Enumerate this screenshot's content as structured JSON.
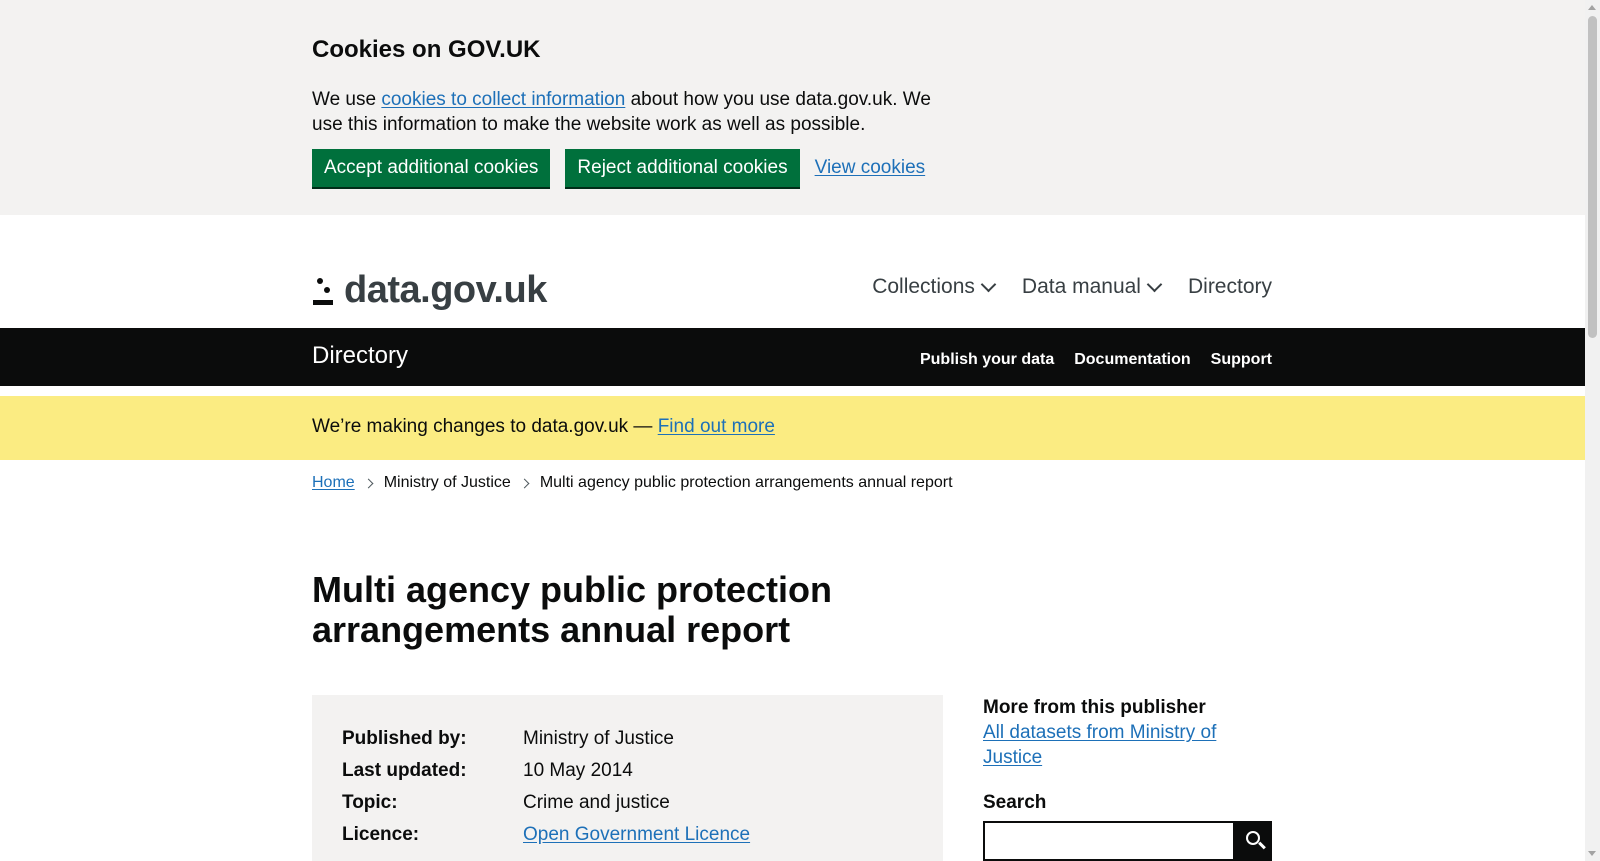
{
  "cookie_banner": {
    "heading": "Cookies on GOV.UK",
    "text_before": "We use ",
    "link_text": "cookies to collect information",
    "text_after": " about how you use data.gov.uk. We use this information to make the website work as well as possible.",
    "accept_label": "Accept additional cookies",
    "reject_label": "Reject additional cookies",
    "view_label": "View cookies"
  },
  "header": {
    "logo_text": "data.gov.uk",
    "nav": [
      {
        "label": "Collections"
      },
      {
        "label": "Data manual"
      },
      {
        "label": "Directory"
      }
    ]
  },
  "subheader": {
    "title": "Directory",
    "links": [
      "Publish your data",
      "Documentation",
      "Support"
    ]
  },
  "notice": {
    "text": "We’re making changes to data.gov.uk — ",
    "link": "Find out more"
  },
  "breadcrumbs": [
    "Home",
    "Ministry of Justice",
    "Multi agency public protection arrangements annual report"
  ],
  "page_title": "Multi agency public protection arrangements annual report",
  "metadata": [
    {
      "key": "Published by:",
      "value": "Ministry of Justice"
    },
    {
      "key": "Last updated:",
      "value": "10 May 2014"
    },
    {
      "key": "Topic:",
      "value": "Crime and justice"
    },
    {
      "key": "Licence:",
      "value": "Open Government Licence"
    }
  ],
  "sidebar": {
    "more_heading": "More from this publisher",
    "more_link": "All datasets from Ministry of Justice",
    "search_label": "Search",
    "search_value": "",
    "search_icon": "search-icon"
  },
  "colors": {
    "button_green": "#00703c",
    "link_blue": "#1d70b8",
    "notice_yellow": "#fbec82",
    "banner_grey": "#f3f2f1",
    "bar_black": "#0b0c0c"
  }
}
